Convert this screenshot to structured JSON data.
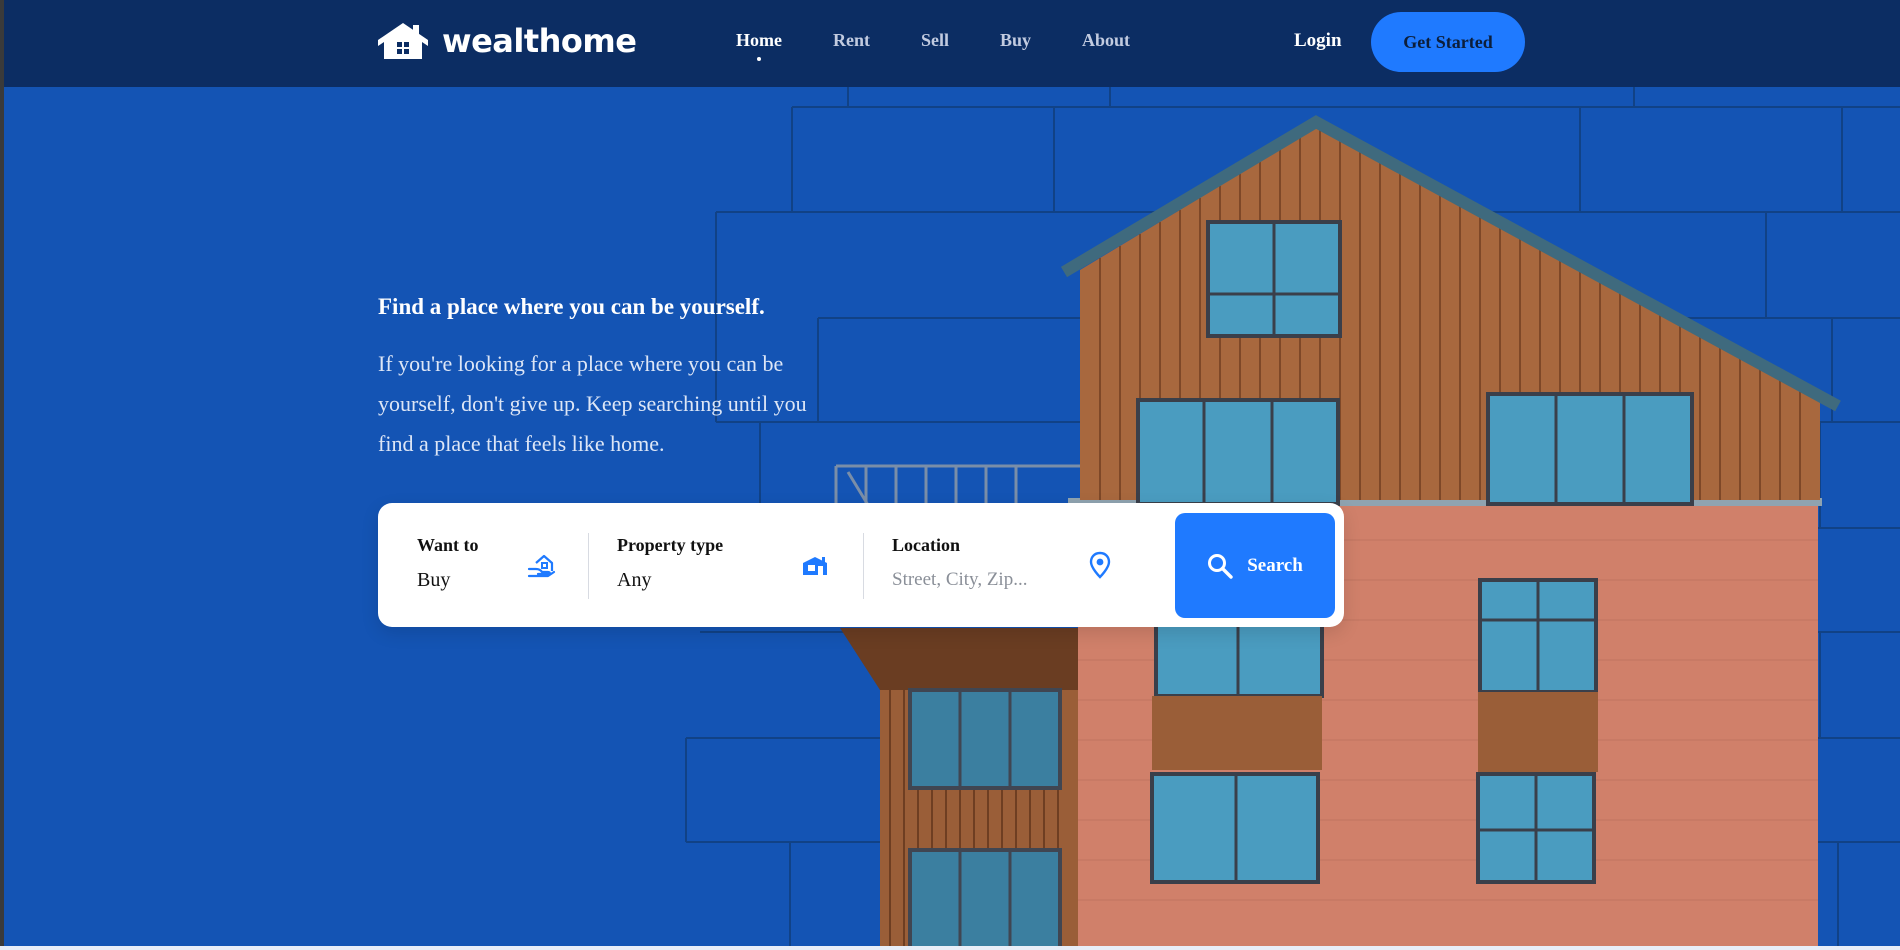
{
  "colors": {
    "header_bg": "#0c2d63",
    "hero_bg": "#1454b4",
    "accent": "#1f7aff",
    "white": "#ffffff"
  },
  "header": {
    "logo_text": "wealthome",
    "logo_icon": "house-logo-icon",
    "nav": [
      {
        "label": "Home",
        "active": true
      },
      {
        "label": "Rent",
        "active": false
      },
      {
        "label": "Sell",
        "active": false
      },
      {
        "label": "Buy",
        "active": false
      },
      {
        "label": "About",
        "active": false
      }
    ],
    "login_label": "Login",
    "cta_label": "Get Started"
  },
  "hero": {
    "heading": "Find a place where you can be yourself.",
    "description": "If you're looking for a place where you can be yourself, don't give up. Keep searching until you find a place that feels like home."
  },
  "search": {
    "want_to": {
      "label": "Want to",
      "value": "Buy",
      "icon": "home-hand-icon"
    },
    "property_type": {
      "label": "Property type",
      "value": "Any",
      "icon": "house-building-icon"
    },
    "location": {
      "label": "Location",
      "placeholder": "Street, City, Zip...",
      "icon": "map-pin-icon"
    },
    "button_label": "Search",
    "button_icon": "search-icon"
  }
}
